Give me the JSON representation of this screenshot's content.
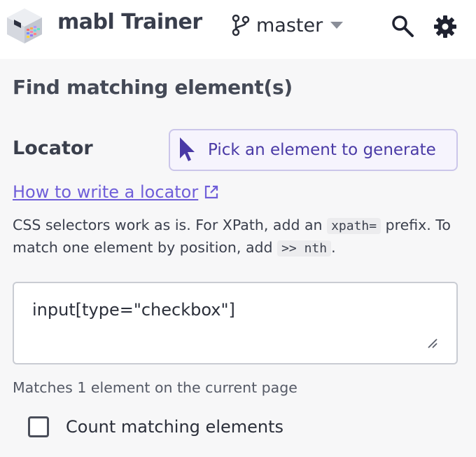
{
  "header": {
    "app_title": "mabl Trainer",
    "branch": "master"
  },
  "panel": {
    "title": "Find matching element(s)",
    "locator_label": "Locator",
    "pick_button_label": "Pick an element to generate",
    "howto_link": "How to write a locator",
    "help": {
      "part1": "CSS selectors work as is. For XPath, add an ",
      "code1": "xpath=",
      "part2": " prefix. To match one element by position, add ",
      "code2": ">> nth",
      "part3": "."
    },
    "locator_value": "input[type=\"checkbox\"]",
    "matches_text": "Matches 1 element on the current page",
    "count_label": "Count matching elements",
    "count_checked": false
  },
  "colors": {
    "accent": "#6f5ed9",
    "accent_dark": "#4a3aa6",
    "panel_bg": "#f7f7f8"
  },
  "icons": [
    "mabl-logo-icon",
    "git-branch-icon",
    "chevron-down-icon",
    "search-icon",
    "gear-icon",
    "cursor-arrow-icon",
    "external-link-icon",
    "resize-grip-icon"
  ]
}
